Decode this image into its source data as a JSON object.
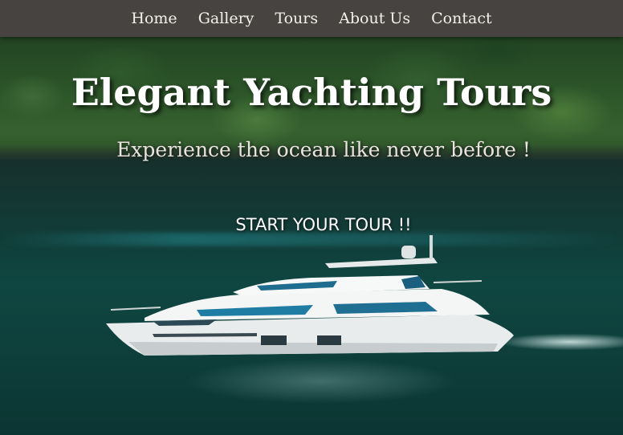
{
  "nav": {
    "items": [
      {
        "label": "Home"
      },
      {
        "label": "Gallery"
      },
      {
        "label": "Tours"
      },
      {
        "label": "About Us"
      },
      {
        "label": "Contact"
      }
    ]
  },
  "hero": {
    "title": "Elegant Yachting Tours",
    "subtitle": "Experience the ocean like never before !",
    "cta_label": "START YOUR TOUR !!"
  },
  "colors": {
    "navbar": "#474341",
    "water": "#0f4641",
    "text": "#ffffff"
  }
}
